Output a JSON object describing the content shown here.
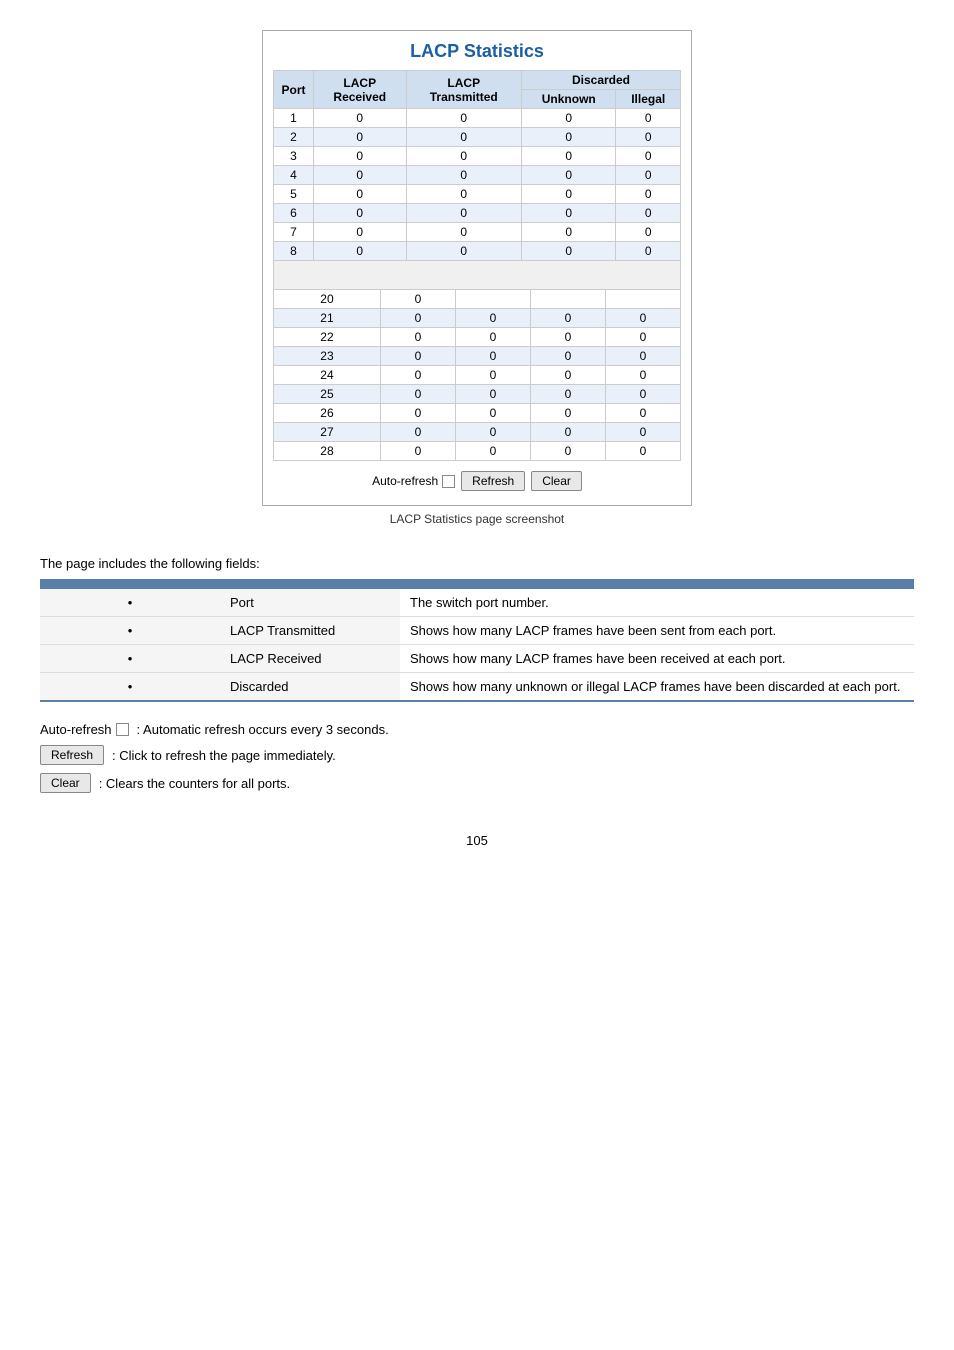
{
  "screenshot": {
    "title": "LACP Statistics",
    "caption": "LACP Statistics page screenshot",
    "table": {
      "headers": {
        "port": "Port",
        "lacp_received": "LACP\nReceived",
        "lacp_transmitted": "LACP\nTransmitted",
        "discarded": "Discarded",
        "unknown": "Unknown",
        "illegal": "Illegal"
      },
      "rows_top": [
        {
          "port": "1",
          "received": "0",
          "transmitted": "0",
          "unknown": "0",
          "illegal": "0"
        },
        {
          "port": "2",
          "received": "0",
          "transmitted": "0",
          "unknown": "0",
          "illegal": "0"
        },
        {
          "port": "3",
          "received": "0",
          "transmitted": "0",
          "unknown": "0",
          "illegal": "0"
        },
        {
          "port": "4",
          "received": "0",
          "transmitted": "0",
          "unknown": "0",
          "illegal": "0"
        },
        {
          "port": "5",
          "received": "0",
          "transmitted": "0",
          "unknown": "0",
          "illegal": "0"
        },
        {
          "port": "6",
          "received": "0",
          "transmitted": "0",
          "unknown": "0",
          "illegal": "0"
        },
        {
          "port": "7",
          "received": "0",
          "transmitted": "0",
          "unknown": "0",
          "illegal": "0"
        },
        {
          "port": "8",
          "received": "0",
          "transmitted": "0",
          "unknown": "0",
          "illegal": "0"
        }
      ],
      "rows_bottom": [
        {
          "port": "20",
          "received": "0",
          "transmitted": "",
          "unknown": "",
          "illegal": ""
        },
        {
          "port": "21",
          "received": "0",
          "transmitted": "0",
          "unknown": "0",
          "illegal": "0"
        },
        {
          "port": "22",
          "received": "0",
          "transmitted": "0",
          "unknown": "0",
          "illegal": "0"
        },
        {
          "port": "23",
          "received": "0",
          "transmitted": "0",
          "unknown": "0",
          "illegal": "0"
        },
        {
          "port": "24",
          "received": "0",
          "transmitted": "0",
          "unknown": "0",
          "illegal": "0"
        },
        {
          "port": "25",
          "received": "0",
          "transmitted": "0",
          "unknown": "0",
          "illegal": "0"
        },
        {
          "port": "26",
          "received": "0",
          "transmitted": "0",
          "unknown": "0",
          "illegal": "0"
        },
        {
          "port": "27",
          "received": "0",
          "transmitted": "0",
          "unknown": "0",
          "illegal": "0"
        },
        {
          "port": "28",
          "received": "0",
          "transmitted": "0",
          "unknown": "0",
          "illegal": "0"
        }
      ]
    },
    "controls": {
      "auto_refresh_label": "Auto-refresh",
      "refresh_button": "Refresh",
      "clear_button": "Clear"
    }
  },
  "description": {
    "intro": "The page includes the following fields:",
    "fields": [
      {
        "name": "Port",
        "description": "The switch port number."
      },
      {
        "name": "LACP Transmitted",
        "description": "Shows how many LACP frames have been sent from each port."
      },
      {
        "name": "LACP Received",
        "description": "Shows how many LACP frames have been received at each port."
      },
      {
        "name": "Discarded",
        "description": "Shows how many unknown or illegal LACP frames have been discarded at each port."
      }
    ]
  },
  "button_descriptions": [
    {
      "type": "auto-refresh",
      "label": "Auto-refresh",
      "description": "Automatic refresh occurs every 3 seconds."
    },
    {
      "type": "button",
      "label": "Refresh",
      "description": "Click to refresh the page immediately."
    },
    {
      "type": "button",
      "label": "Clear",
      "description": "Clears the counters for all ports."
    }
  ],
  "page_number": "105"
}
